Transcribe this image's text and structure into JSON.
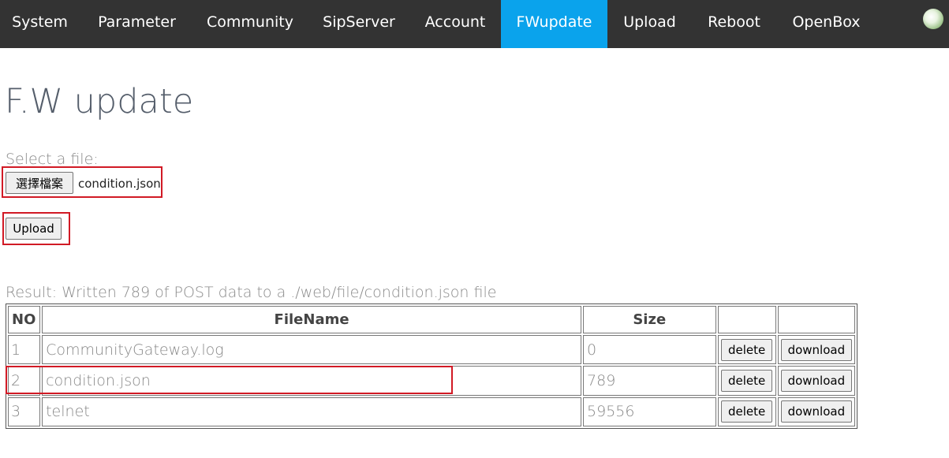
{
  "nav": {
    "items": [
      {
        "label": "System",
        "active": false
      },
      {
        "label": "Parameter",
        "active": false
      },
      {
        "label": "Community",
        "active": false
      },
      {
        "label": "SipServer",
        "active": false
      },
      {
        "label": "Account",
        "active": false
      },
      {
        "label": "FWupdate",
        "active": true
      },
      {
        "label": "Upload",
        "active": false
      },
      {
        "label": "Reboot",
        "active": false
      },
      {
        "label": "OpenBox",
        "active": false
      }
    ],
    "status_icon": "status-indicator-icon",
    "colors": {
      "bar": "#333333",
      "active": "#0aa3ec"
    }
  },
  "page": {
    "title": "F.W update",
    "select_label": "Select a file:",
    "choose_file_label": "選擇檔案",
    "selected_file": "condition.json",
    "upload_label": "Upload",
    "result": "Result: Written 789 of POST data to a ./web/file/condition.json file"
  },
  "table": {
    "headers": {
      "no": "NO",
      "filename": "FileName",
      "size": "Size",
      "col4": "",
      "col5": ""
    },
    "rows": [
      {
        "no": "1",
        "filename": "CommunityGateway.log",
        "size": "0",
        "delete": "delete",
        "download": "download"
      },
      {
        "no": "2",
        "filename": "condition.json",
        "size": "789",
        "delete": "delete",
        "download": "download"
      },
      {
        "no": "3",
        "filename": "telnet",
        "size": "59556",
        "delete": "delete",
        "download": "download"
      }
    ]
  },
  "highlight_color": "#d11a25"
}
